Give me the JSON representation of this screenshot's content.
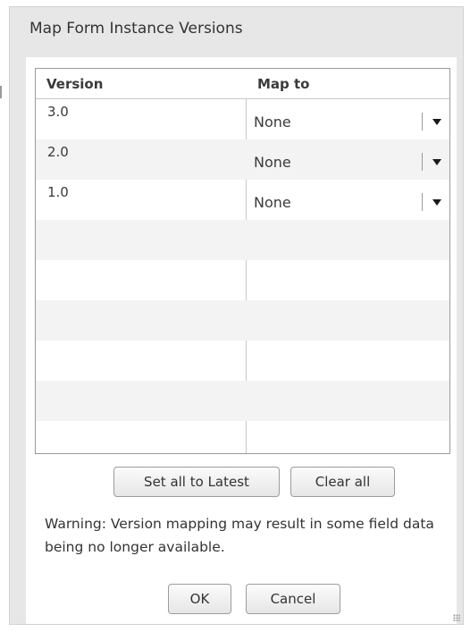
{
  "dialog": {
    "title": "Map Form Instance Versions"
  },
  "table": {
    "headers": {
      "version": "Version",
      "map_to": "Map to"
    },
    "rows": [
      {
        "version": "3.0",
        "map_to": "None"
      },
      {
        "version": "2.0",
        "map_to": "None"
      },
      {
        "version": "1.0",
        "map_to": "None"
      }
    ]
  },
  "buttons": {
    "set_all_latest": "Set all to Latest",
    "clear_all": "Clear all",
    "ok": "OK",
    "cancel": "Cancel"
  },
  "warning": "Warning: Version mapping may result in some field data being no longer available.",
  "icons": {
    "dropdown": "chevron-down-icon",
    "resize": "resize-grip-icon"
  }
}
